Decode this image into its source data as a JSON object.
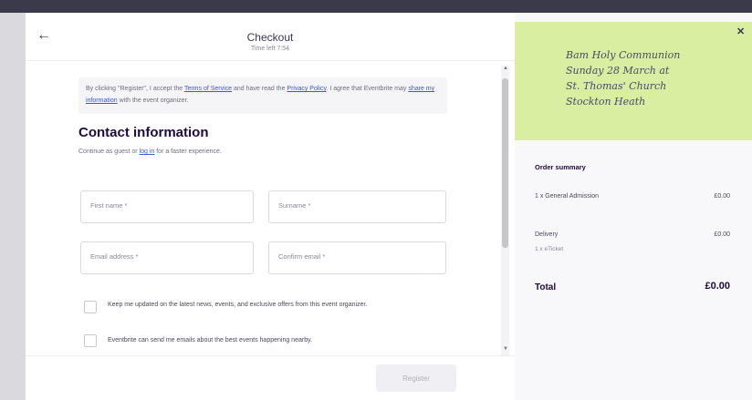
{
  "header": {
    "title": "Checkout",
    "timer": "Time left 7:54"
  },
  "consent": {
    "text_1": "By clicking \"Register\", I accept the ",
    "terms_link": "Terms of Service",
    "text_2": " and have read the ",
    "privacy_link": "Privacy Policy",
    "text_3": ". I agree that Eventbrite may ",
    "share_link": "share my information",
    "text_4": " with the event organizer."
  },
  "contact": {
    "title": "Contact information",
    "sub_1": "Continue as guest or ",
    "login_link": "log in",
    "sub_2": " for a faster experience.",
    "first_name_placeholder": "First name *",
    "surname_placeholder": "Surname *",
    "email_placeholder": "Email address *",
    "confirm_email_placeholder": "Confirm email *",
    "checkbox_updates": "Keep me updated on the latest news, events, and exclusive offers from this event organizer.",
    "checkbox_nearby": "Eventbrite can send me emails about the best events happening nearby."
  },
  "footer": {
    "register_label": "Register"
  },
  "event": {
    "line_1": "Bam Holy Communion",
    "line_2": "Sunday 28 March at",
    "line_3": "St. Thomas' Church",
    "line_4": "Stockton Heath"
  },
  "summary": {
    "title": "Order summary",
    "items": [
      {
        "label": "1 x General Admission",
        "amount": "£0.00"
      },
      {
        "label": "Delivery",
        "amount": "£0.00"
      }
    ],
    "delivery_sub": "1 x eTicket",
    "total_label": "Total",
    "total_amount": "£0.00"
  },
  "icons": {
    "back": "arrow-left-icon",
    "close": "close-icon"
  }
}
